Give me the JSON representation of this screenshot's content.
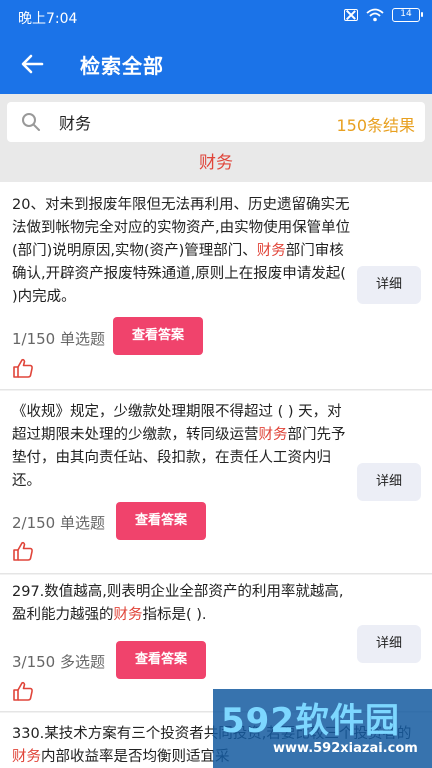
{
  "status": {
    "time": "晚上7:04",
    "battery": "14"
  },
  "header": {
    "title": "检索全部"
  },
  "search": {
    "value": "财务",
    "result_count": "150条结果"
  },
  "section": {
    "title": "财务"
  },
  "questions": [
    {
      "pre": "20、对未到报废年限但无法再利用、历史遗留确实无法做到帐物完全对应的实物资产,由实物使用保管单位(部门)说明原因,实物(资产)管理部门、",
      "hl": "财务",
      "post": "部门审核确认,开辟资产报废特殊通道,原则上在报废申请发起( )内完成。",
      "index": "1/150",
      "type": "单选题",
      "answer_label": "查看答案",
      "detail_label": "详细"
    },
    {
      "pre": "《收规》规定，少缴款处理期限不得超过 ( ) 天，对超过期限未处理的少缴款，转同级运营",
      "hl": "财务",
      "post": "部门先予垫付，由其向责任站、段扣款，在责任人工资内归还。",
      "index": "2/150",
      "type": "单选题",
      "answer_label": "查看答案",
      "detail_label": "详细"
    },
    {
      "pre": "297.数值越高,则表明企业全部资产的利用率就越高,盈利能力越强的",
      "hl": "财务",
      "post": "指标是( ).",
      "index": "3/150",
      "type": "多选题",
      "answer_label": "查看答案",
      "detail_label": "详细"
    },
    {
      "pre": "330.某技术方案有三个投资者共同投资,若要比较三个投资者的",
      "hl": "财务",
      "post": "内部收益率是否均衡则适宜采",
      "index": "",
      "type": "",
      "answer_label": "",
      "detail_label": ""
    }
  ],
  "watermark": {
    "brand": "592软件园",
    "url": "www.592xiazai.com"
  },
  "colors": {
    "primary": "#1b73e8",
    "highlight": "#e0453a",
    "answer_button": "#f0436c",
    "count": "#e8a020"
  }
}
